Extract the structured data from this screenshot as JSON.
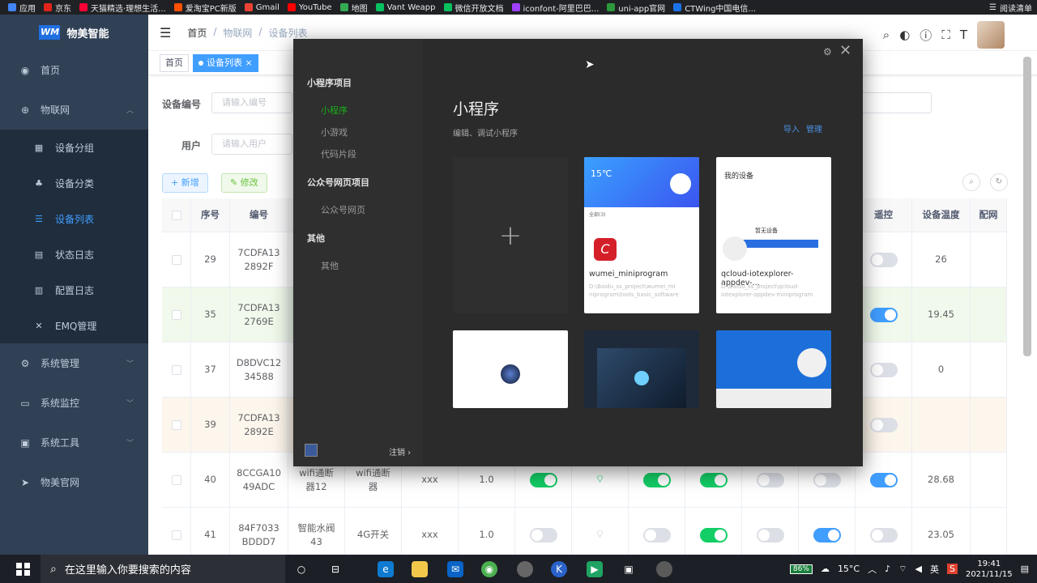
{
  "bookmarks": [
    "应用",
    "京东",
    "天猫精选·理想生活...",
    "爱淘宝PC新版",
    "Gmail",
    "YouTube",
    "地图",
    "Vant Weapp",
    "微信开放文档",
    "iconfont-阿里巴巴...",
    "uni-app官网",
    "CTWing中国电信..."
  ],
  "bookmark_right": "阅读清单",
  "app": {
    "logo_mark": "WM",
    "title": "物美智能"
  },
  "sidebar": {
    "home": "首页",
    "iot": "物联网",
    "sub": [
      "设备分组",
      "设备分类",
      "设备列表",
      "状态日志",
      "配置日志",
      "EMQ管理"
    ],
    "system": "系统管理",
    "monitor": "系统监控",
    "tools": "系统工具",
    "site": "物美官网"
  },
  "breadcrumb": [
    "首页",
    "物联网",
    "设备列表"
  ],
  "tags": {
    "home": "首页",
    "current": "设备列表",
    "close": "×"
  },
  "filters": {
    "device_no_label": "设备编号",
    "device_no_placeholder": "请输入编号",
    "user_label": "用户",
    "user_placeholder": "请输入用户"
  },
  "buttons": {
    "add": "+ 新增",
    "edit": "✎ 修改"
  },
  "table": {
    "headers": {
      "index": "序号",
      "code": "编号",
      "remote": "遥控",
      "temp": "设备温度",
      "net": "配网"
    },
    "rows": [
      {
        "index": "29",
        "code": "7CDFA13\n2892F",
        "name": "",
        "cat": "",
        "user": "",
        "ver": "",
        "temp": "26"
      },
      {
        "index": "35",
        "code": "7CDFA13\n2769E",
        "name": "",
        "cat": "",
        "user": "",
        "ver": "",
        "temp": "19.45"
      },
      {
        "index": "37",
        "code": "D8DVC12\n34588",
        "name": "",
        "cat": "",
        "user": "",
        "ver": "",
        "temp": "0"
      },
      {
        "index": "39",
        "code": "7CDFA13\n2892E",
        "name": "",
        "cat": "",
        "user": "",
        "ver": "",
        "temp": ""
      },
      {
        "index": "40",
        "code": "8CCGA10\n49ADC",
        "name": "wifi通断\n器12",
        "cat": "wifi通断\n器",
        "user": "xxx",
        "ver": "1.0",
        "temp": "28.68"
      },
      {
        "index": "41",
        "code": "84F7033\nBDDD7",
        "name": "智能水阀\n43",
        "cat": "4G开关",
        "user": "xxx",
        "ver": "1.0",
        "temp": "23.05"
      }
    ]
  },
  "dialog": {
    "groups": [
      {
        "label": "小程序项目",
        "items": [
          "小程序",
          "小游戏",
          "代码片段"
        ]
      },
      {
        "label": "公众号网页项目",
        "items": [
          "公众号网页"
        ]
      },
      {
        "label": "其他",
        "items": [
          "其他"
        ]
      }
    ],
    "title": "小程序",
    "subtitle": "编辑、调试小程序",
    "import": "导入",
    "manage": "管理",
    "logout": "注销 ›",
    "new_plus": "+",
    "cards": [
      {
        "name": "wumei_miniprogram",
        "path": "D:\\Baidu_ss_project\\wumei_mi niprogram\\tools_basic_software",
        "temp": "15℃",
        "section": "全部(3)"
      },
      {
        "name": "qcloud-iotexplorer-appdev-...",
        "path": "D:\\baidu_ss_project\\qcloud-iotexplorer-appdev-miniprogram",
        "header": "我的设备",
        "empty": "暂无设备"
      }
    ]
  },
  "taskbar": {
    "search_placeholder": "在这里输入你要搜索的内容",
    "battery": "86%",
    "weather": "15°C",
    "ime": "英",
    "time": "19:41",
    "date": "2021/11/15"
  },
  "colors": {
    "sidebar": "#304156",
    "accent": "#409eff",
    "switch_on": "#13ce66",
    "dialog_bg": "#2b2b2b",
    "wechat_green": "#1aad19"
  }
}
